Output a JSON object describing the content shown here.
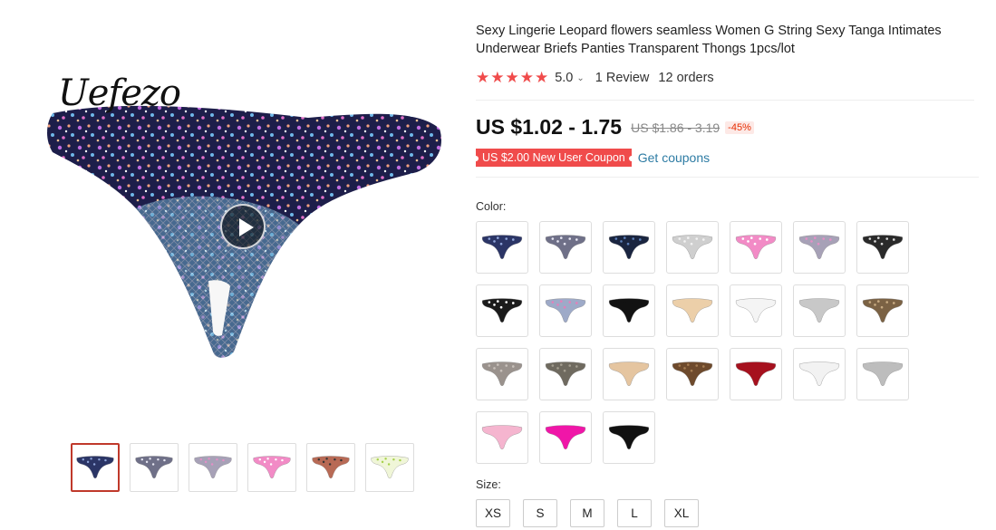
{
  "brand": {
    "logo_text": "Uefezo"
  },
  "product": {
    "title": "Sexy Lingerie Leopard flowers seamless Women G String Sexy Tanga Intimates Underwear Briefs Panties Transparent Thongs 1pcs/lot",
    "stars": "★★★★★",
    "rating": "5.0",
    "reviews": "1 Review",
    "orders": "12 orders",
    "price": "US $1.02 - 1.75",
    "old_price": "US $1.86 - 3.19",
    "discount": "-45%",
    "coupon": "US $2.00 New User Coupon",
    "get_coupons": "Get coupons"
  },
  "colors": {
    "label": "Color:",
    "accent": "#f04b4b",
    "swatches": [
      {
        "fill": "#2b3566",
        "pattern": "#8fa4d9"
      },
      {
        "fill": "#6f7088",
        "pattern": "#e6e6f2"
      },
      {
        "fill": "#1a2540",
        "pattern": "#5c7fb8"
      },
      {
        "fill": "#cfcfcf",
        "pattern": "#f2f2f2"
      },
      {
        "fill": "#f28bc6",
        "pattern": "#ffffff"
      },
      {
        "fill": "#a7a1b7",
        "pattern": "#e48fc6"
      },
      {
        "fill": "#2a2a2a",
        "pattern": "#d9d9d9"
      },
      {
        "fill": "#1b1b1b",
        "pattern": "#ffffff"
      },
      {
        "fill": "#9eaac8",
        "pattern": "#e57fb9"
      },
      {
        "fill": "#121212",
        "pattern": "#121212"
      },
      {
        "fill": "#eccfa9",
        "pattern": "#eccfa9"
      },
      {
        "fill": "#f4f4f4",
        "pattern": "#f4f4f4"
      },
      {
        "fill": "#c8c8c8",
        "pattern": "#c8c8c8"
      },
      {
        "fill": "#7b6244",
        "pattern": "#c8ab82"
      },
      {
        "fill": "#9a928d",
        "pattern": "#c8c0ba"
      },
      {
        "fill": "#6f6a5f",
        "pattern": "#a39d8f"
      },
      {
        "fill": "#e5c5a0",
        "pattern": "#e5c5a0"
      },
      {
        "fill": "#6e4a2c",
        "pattern": "#a57c52"
      },
      {
        "fill": "#a6111e",
        "pattern": "#a6111e"
      },
      {
        "fill": "#f2f2f2",
        "pattern": "#f2f2f2"
      },
      {
        "fill": "#bdbdbd",
        "pattern": "#bdbdbd"
      },
      {
        "fill": "#f5b5cf",
        "pattern": "#f5b5cf"
      },
      {
        "fill": "#f016a8",
        "pattern": "#f016a8"
      },
      {
        "fill": "#111111",
        "pattern": "#111111"
      }
    ]
  },
  "sizes": {
    "label": "Size:",
    "options": [
      "XS",
      "S",
      "M",
      "L",
      "XL"
    ]
  },
  "thumbnails": [
    {
      "fill": "#2b3566",
      "pattern": "#8fa4d9"
    },
    {
      "fill": "#6f7088",
      "pattern": "#e6e6f2"
    },
    {
      "fill": "#a7a1b7",
      "pattern": "#e48fc6"
    },
    {
      "fill": "#f28bc6",
      "pattern": "#ffffff"
    },
    {
      "fill": "#b86a55",
      "pattern": "#333333"
    },
    {
      "fill": "#f0f6d8",
      "pattern": "#a6d14a"
    }
  ]
}
